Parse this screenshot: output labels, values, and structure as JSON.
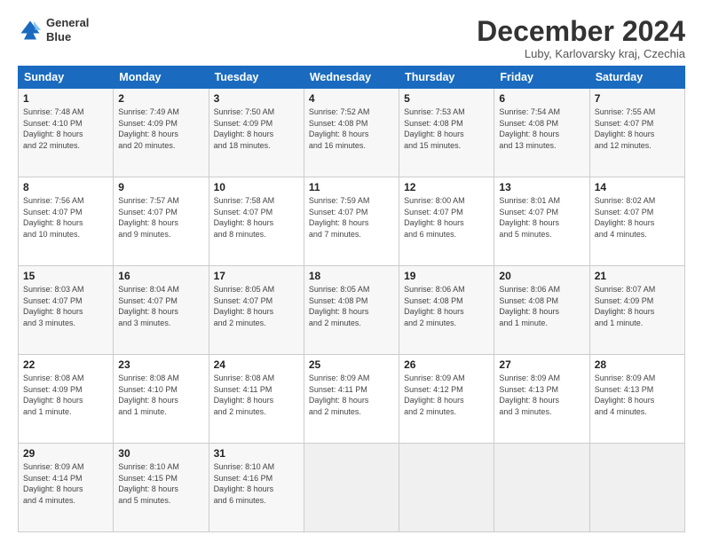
{
  "header": {
    "logo_line1": "General",
    "logo_line2": "Blue",
    "month_title": "December 2024",
    "location": "Luby, Karlovarsky kraj, Czechia"
  },
  "weekdays": [
    "Sunday",
    "Monday",
    "Tuesday",
    "Wednesday",
    "Thursday",
    "Friday",
    "Saturday"
  ],
  "weeks": [
    [
      {
        "day": "1",
        "info": "Sunrise: 7:48 AM\nSunset: 4:10 PM\nDaylight: 8 hours\nand 22 minutes."
      },
      {
        "day": "2",
        "info": "Sunrise: 7:49 AM\nSunset: 4:09 PM\nDaylight: 8 hours\nand 20 minutes."
      },
      {
        "day": "3",
        "info": "Sunrise: 7:50 AM\nSunset: 4:09 PM\nDaylight: 8 hours\nand 18 minutes."
      },
      {
        "day": "4",
        "info": "Sunrise: 7:52 AM\nSunset: 4:08 PM\nDaylight: 8 hours\nand 16 minutes."
      },
      {
        "day": "5",
        "info": "Sunrise: 7:53 AM\nSunset: 4:08 PM\nDaylight: 8 hours\nand 15 minutes."
      },
      {
        "day": "6",
        "info": "Sunrise: 7:54 AM\nSunset: 4:08 PM\nDaylight: 8 hours\nand 13 minutes."
      },
      {
        "day": "7",
        "info": "Sunrise: 7:55 AM\nSunset: 4:07 PM\nDaylight: 8 hours\nand 12 minutes."
      }
    ],
    [
      {
        "day": "8",
        "info": "Sunrise: 7:56 AM\nSunset: 4:07 PM\nDaylight: 8 hours\nand 10 minutes."
      },
      {
        "day": "9",
        "info": "Sunrise: 7:57 AM\nSunset: 4:07 PM\nDaylight: 8 hours\nand 9 minutes."
      },
      {
        "day": "10",
        "info": "Sunrise: 7:58 AM\nSunset: 4:07 PM\nDaylight: 8 hours\nand 8 minutes."
      },
      {
        "day": "11",
        "info": "Sunrise: 7:59 AM\nSunset: 4:07 PM\nDaylight: 8 hours\nand 7 minutes."
      },
      {
        "day": "12",
        "info": "Sunrise: 8:00 AM\nSunset: 4:07 PM\nDaylight: 8 hours\nand 6 minutes."
      },
      {
        "day": "13",
        "info": "Sunrise: 8:01 AM\nSunset: 4:07 PM\nDaylight: 8 hours\nand 5 minutes."
      },
      {
        "day": "14",
        "info": "Sunrise: 8:02 AM\nSunset: 4:07 PM\nDaylight: 8 hours\nand 4 minutes."
      }
    ],
    [
      {
        "day": "15",
        "info": "Sunrise: 8:03 AM\nSunset: 4:07 PM\nDaylight: 8 hours\nand 3 minutes."
      },
      {
        "day": "16",
        "info": "Sunrise: 8:04 AM\nSunset: 4:07 PM\nDaylight: 8 hours\nand 3 minutes."
      },
      {
        "day": "17",
        "info": "Sunrise: 8:05 AM\nSunset: 4:07 PM\nDaylight: 8 hours\nand 2 minutes."
      },
      {
        "day": "18",
        "info": "Sunrise: 8:05 AM\nSunset: 4:08 PM\nDaylight: 8 hours\nand 2 minutes."
      },
      {
        "day": "19",
        "info": "Sunrise: 8:06 AM\nSunset: 4:08 PM\nDaylight: 8 hours\nand 2 minutes."
      },
      {
        "day": "20",
        "info": "Sunrise: 8:06 AM\nSunset: 4:08 PM\nDaylight: 8 hours\nand 1 minute."
      },
      {
        "day": "21",
        "info": "Sunrise: 8:07 AM\nSunset: 4:09 PM\nDaylight: 8 hours\nand 1 minute."
      }
    ],
    [
      {
        "day": "22",
        "info": "Sunrise: 8:08 AM\nSunset: 4:09 PM\nDaylight: 8 hours\nand 1 minute."
      },
      {
        "day": "23",
        "info": "Sunrise: 8:08 AM\nSunset: 4:10 PM\nDaylight: 8 hours\nand 1 minute."
      },
      {
        "day": "24",
        "info": "Sunrise: 8:08 AM\nSunset: 4:11 PM\nDaylight: 8 hours\nand 2 minutes."
      },
      {
        "day": "25",
        "info": "Sunrise: 8:09 AM\nSunset: 4:11 PM\nDaylight: 8 hours\nand 2 minutes."
      },
      {
        "day": "26",
        "info": "Sunrise: 8:09 AM\nSunset: 4:12 PM\nDaylight: 8 hours\nand 2 minutes."
      },
      {
        "day": "27",
        "info": "Sunrise: 8:09 AM\nSunset: 4:13 PM\nDaylight: 8 hours\nand 3 minutes."
      },
      {
        "day": "28",
        "info": "Sunrise: 8:09 AM\nSunset: 4:13 PM\nDaylight: 8 hours\nand 4 minutes."
      }
    ],
    [
      {
        "day": "29",
        "info": "Sunrise: 8:09 AM\nSunset: 4:14 PM\nDaylight: 8 hours\nand 4 minutes."
      },
      {
        "day": "30",
        "info": "Sunrise: 8:10 AM\nSunset: 4:15 PM\nDaylight: 8 hours\nand 5 minutes."
      },
      {
        "day": "31",
        "info": "Sunrise: 8:10 AM\nSunset: 4:16 PM\nDaylight: 8 hours\nand 6 minutes."
      },
      null,
      null,
      null,
      null
    ]
  ]
}
